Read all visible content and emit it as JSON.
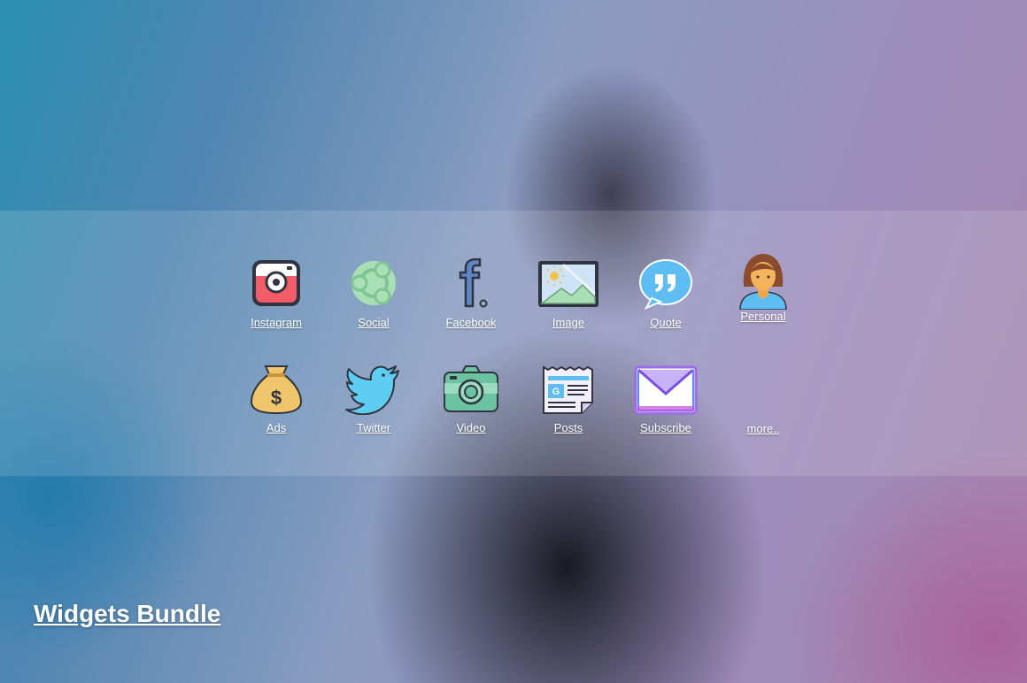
{
  "title": "Widgets Bundle",
  "widgets": [
    {
      "label": "Instagram",
      "icon": "instagram-icon"
    },
    {
      "label": "Social",
      "icon": "social-share-icon"
    },
    {
      "label": "Facebook",
      "icon": "facebook-icon"
    },
    {
      "label": "Image",
      "icon": "image-icon"
    },
    {
      "label": "Quote",
      "icon": "quote-bubble-icon"
    },
    {
      "label": "Personal",
      "icon": "person-icon"
    },
    {
      "label": "Ads",
      "icon": "money-bag-icon"
    },
    {
      "label": "Twitter",
      "icon": "twitter-bird-icon"
    },
    {
      "label": "Video",
      "icon": "camera-icon"
    },
    {
      "label": "Posts",
      "icon": "newspaper-icon"
    },
    {
      "label": "Subscribe",
      "icon": "envelope-icon"
    }
  ],
  "more_label": "more..",
  "colors": {
    "band": "#ffffff22",
    "text": "#ffffff"
  }
}
